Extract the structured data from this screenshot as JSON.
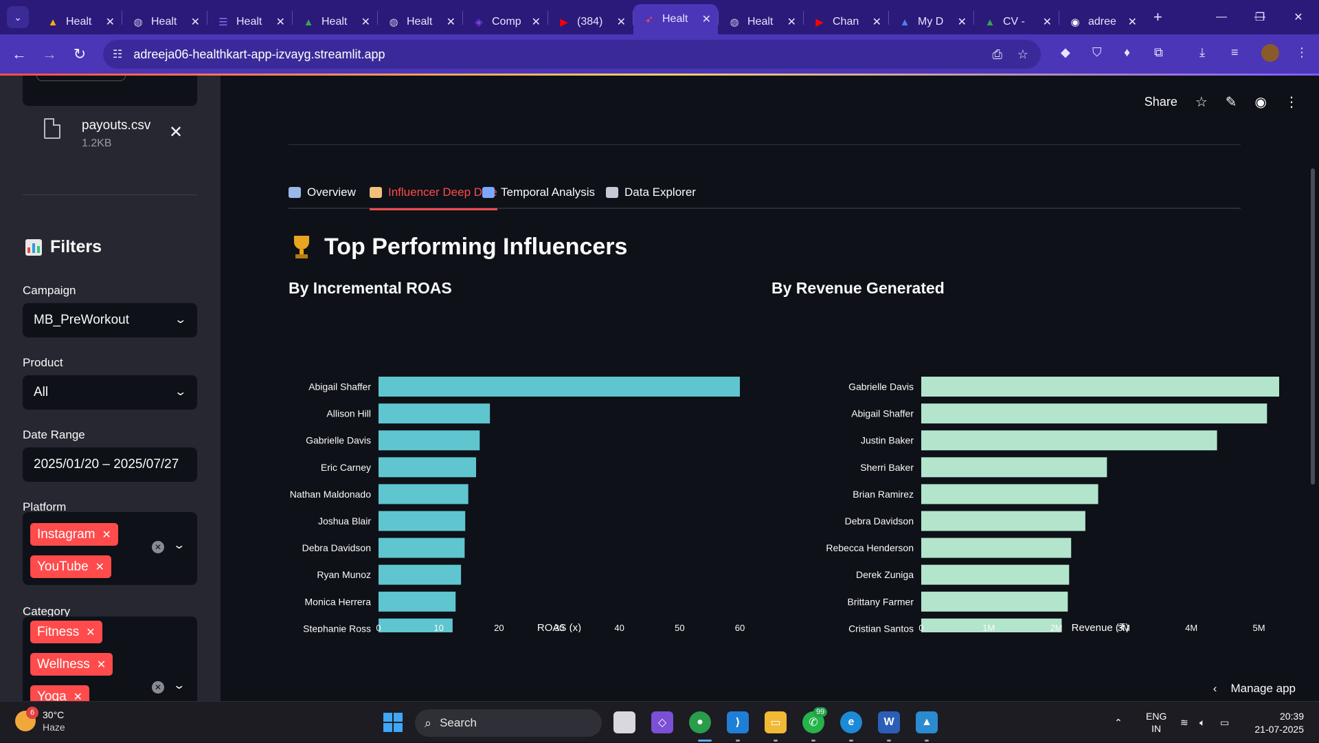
{
  "browser": {
    "tabs": [
      {
        "title": "Healt",
        "fav": "drive",
        "color": "#f4b400"
      },
      {
        "title": "Healt",
        "fav": "globe",
        "color": "#c9c6e6"
      },
      {
        "title": "Healt",
        "fav": "list",
        "color": "#8e6cf0"
      },
      {
        "title": "Healt",
        "fav": "drive",
        "color": "#34a853"
      },
      {
        "title": "Healt",
        "fav": "globe",
        "color": "#c9c6e6"
      },
      {
        "title": "Comp",
        "fav": "shield",
        "color": "#7b3fe4"
      },
      {
        "title": "(384)",
        "fav": "youtube",
        "color": "#ff0000"
      },
      {
        "title": "Healt",
        "fav": "rocket",
        "color": "#ff4b4b",
        "active": true
      },
      {
        "title": "Healt",
        "fav": "globe",
        "color": "#c9c6e6"
      },
      {
        "title": "Chan",
        "fav": "youtube",
        "color": "#ff0000"
      },
      {
        "title": "My D",
        "fav": "drive",
        "color": "#4285f4"
      },
      {
        "title": "CV -",
        "fav": "drive",
        "color": "#34a853"
      },
      {
        "title": "adree",
        "fav": "github",
        "color": "#ffffff"
      }
    ],
    "url": "adreeja06-healthkart-app-izvayg.streamlit.app"
  },
  "sidebar": {
    "file": {
      "name": "payouts.csv",
      "size": "1.2KB"
    },
    "filters_heading": "Filters",
    "campaign": {
      "label": "Campaign",
      "value": "MB_PreWorkout"
    },
    "product": {
      "label": "Product",
      "value": "All"
    },
    "date_range": {
      "label": "Date Range",
      "value": "2025/01/20 – 2025/07/27"
    },
    "platform": {
      "label": "Platform",
      "chips": [
        "Instagram",
        "YouTube"
      ]
    },
    "category": {
      "label": "Category",
      "chips": [
        "Fitness",
        "Wellness",
        "Yoga"
      ]
    }
  },
  "header": {
    "share_label": "Share"
  },
  "tabs": [
    {
      "label": "Overview",
      "icon_color": "#9ab8e8"
    },
    {
      "label": "Influencer Deep Dive",
      "icon_color": "#f2c07a",
      "active": true
    },
    {
      "label": "Temporal Analysis",
      "icon_color": "#7aa8ff"
    },
    {
      "label": "Data Explorer",
      "icon_color": "#c8c8d8"
    }
  ],
  "section_title": "Top Performing Influencers",
  "charts": {
    "roas_title": "By Incremental ROAS",
    "revenue_title": "By Revenue Generated"
  },
  "chart_data": [
    {
      "type": "bar",
      "orientation": "horizontal",
      "categories": [
        "Abigail Shaffer",
        "Allison Hill",
        "Gabrielle Davis",
        "Eric Carney",
        "Nathan Maldonado",
        "Joshua Blair",
        "Debra Davidson",
        "Ryan Munoz",
        "Monica Herrera",
        "Stephanie Ross"
      ],
      "values": [
        60,
        18.5,
        16.8,
        16.2,
        14.9,
        14.4,
        14.3,
        13.7,
        12.8,
        12.3
      ],
      "xlabel": "ROAS (x)",
      "xlim": [
        0,
        60
      ],
      "ticks": [
        "0",
        "10",
        "20",
        "30",
        "40",
        "50",
        "60"
      ],
      "color": "#5fc5cf"
    },
    {
      "type": "bar",
      "orientation": "horizontal",
      "categories": [
        "Gabrielle Davis",
        "Abigail Shaffer",
        "Justin Baker",
        "Sherri Baker",
        "Brian Ramirez",
        "Debra Davidson",
        "Rebecca Henderson",
        "Derek Zuniga",
        "Brittany Farmer",
        "Cristian Santos"
      ],
      "values": [
        5300000,
        5120000,
        4380000,
        2750000,
        2620000,
        2430000,
        2220000,
        2190000,
        2170000,
        2080000
      ],
      "xlabel": "Revenue (₹)",
      "xlim": [
        0,
        5300000
      ],
      "ticks": [
        "0",
        "1M",
        "2M",
        "3M",
        "4M",
        "5M"
      ],
      "color": "#b3e4cc"
    }
  ],
  "manage_app": "Manage app",
  "taskbar": {
    "weather": {
      "temp": "30°C",
      "desc": "Haze",
      "badge": "6"
    },
    "search_label": "Search",
    "whatsapp_badge": "99",
    "lang": {
      "top": "ENG",
      "bottom": "IN"
    },
    "time": "20:39",
    "date": "21-07-2025"
  }
}
